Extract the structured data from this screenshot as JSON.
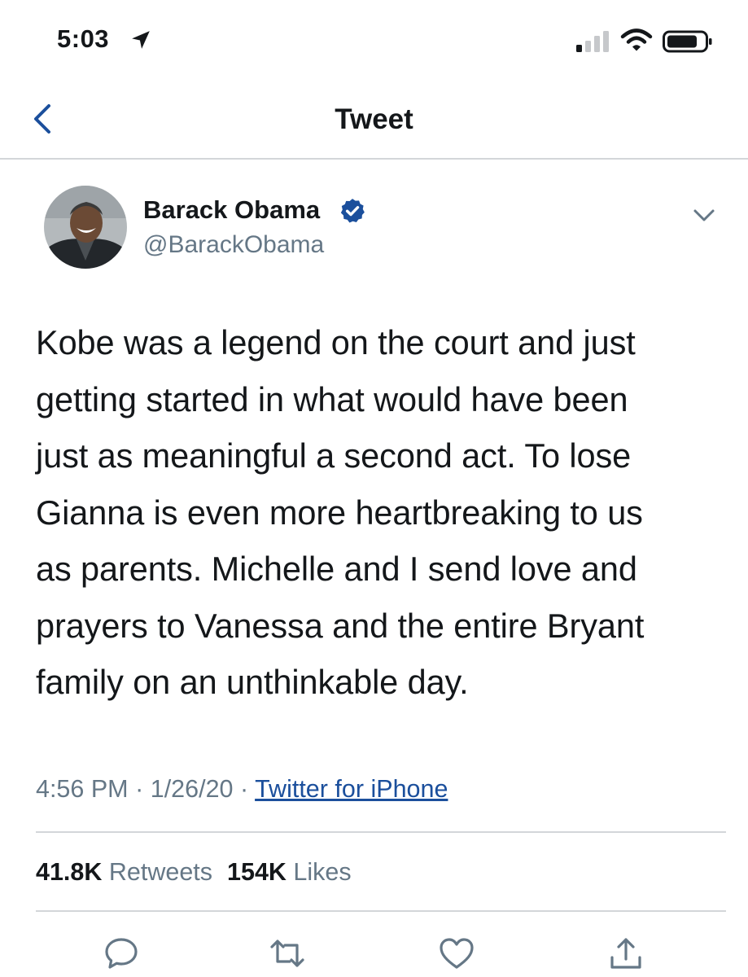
{
  "status_bar": {
    "time": "5:03"
  },
  "header": {
    "title": "Tweet"
  },
  "author": {
    "name": "Barack Obama",
    "handle": "@BarackObama",
    "verified": true
  },
  "tweet": {
    "text": "Kobe was a legend on the court and just\ngetting started in what would have been\njust as meaningful a second act. To lose\nGianna is even more heartbreaking to us\nas parents. Michelle and I send love and\nprayers to Vanessa and the entire Bryant\nfamily on an unthinkable day.",
    "time": "4:56 PM",
    "date": "1/26/20",
    "separator": "·",
    "source": "Twitter for iPhone"
  },
  "stats": {
    "retweets_count": "41.8K",
    "retweets_label": "Retweets",
    "likes_count": "154K",
    "likes_label": "Likes"
  },
  "colors": {
    "accent": "#1b4f9c",
    "secondary_text": "#657786",
    "divider": "#d3d6d9"
  },
  "icons": [
    "location-arrow-icon",
    "signal-icon",
    "wifi-icon",
    "battery-icon",
    "back-chevron-icon",
    "verified-badge-icon",
    "chevron-down-icon",
    "reply-icon",
    "retweet-icon",
    "like-icon",
    "share-icon"
  ]
}
